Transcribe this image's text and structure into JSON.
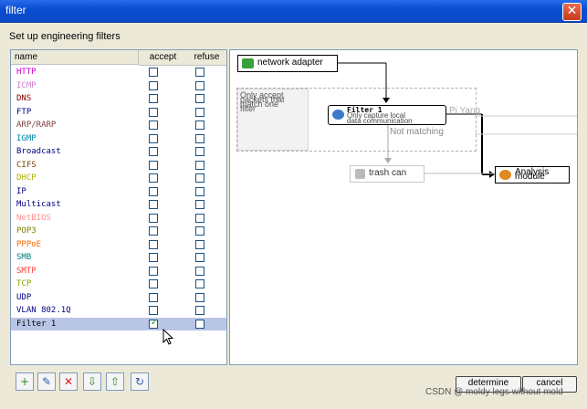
{
  "window": {
    "title": "filter"
  },
  "dialog": {
    "heading": "Set up engineering filters"
  },
  "table": {
    "columns": {
      "name": "name",
      "accept": "accept",
      "refuse": "refuse"
    },
    "rows": [
      {
        "name": "HTTP",
        "color": "#cc00cc",
        "accept": false,
        "refuse": false
      },
      {
        "name": "ICMP",
        "color": "#d080d0",
        "accept": false,
        "refuse": false
      },
      {
        "name": "DNS",
        "color": "#800000",
        "accept": false,
        "refuse": false
      },
      {
        "name": "FTP",
        "color": "#000080",
        "accept": false,
        "refuse": false
      },
      {
        "name": "ARP/RARP",
        "color": "#804040",
        "accept": false,
        "refuse": false
      },
      {
        "name": "IGMP",
        "color": "#0088aa",
        "accept": false,
        "refuse": false
      },
      {
        "name": "Broadcast",
        "color": "#000080",
        "accept": false,
        "refuse": false
      },
      {
        "name": "CIFS",
        "color": "#804000",
        "accept": false,
        "refuse": false
      },
      {
        "name": "DHCP",
        "color": "#b0b000",
        "accept": false,
        "refuse": false
      },
      {
        "name": "IP",
        "color": "#000080",
        "accept": false,
        "refuse": false
      },
      {
        "name": "Multicast",
        "color": "#000080",
        "accept": false,
        "refuse": false
      },
      {
        "name": "NetBIOS",
        "color": "#ff9090",
        "accept": false,
        "refuse": false
      },
      {
        "name": "POP3",
        "color": "#808000",
        "accept": false,
        "refuse": false
      },
      {
        "name": "PPPoE",
        "color": "#ff6600",
        "accept": false,
        "refuse": false
      },
      {
        "name": "SMB",
        "color": "#008080",
        "accept": false,
        "refuse": false
      },
      {
        "name": "SMTP",
        "color": "#ff4040",
        "accept": false,
        "refuse": false
      },
      {
        "name": "TCP",
        "color": "#80a000",
        "accept": false,
        "refuse": false
      },
      {
        "name": "UDP",
        "color": "#000080",
        "accept": false,
        "refuse": false
      },
      {
        "name": "VLAN 802.1Q",
        "color": "#000080",
        "accept": false,
        "refuse": false
      },
      {
        "name": "Filter 1",
        "color": "#000000",
        "accept": true,
        "refuse": false,
        "selected": true
      }
    ]
  },
  "diagram": {
    "network_adapter": "network adapter",
    "grey_line1": "Only accept",
    "grey_line2": "packets that",
    "grey_line3": "match one",
    "grey_line4": "filter",
    "filter1_title": "Filter 1",
    "filter1_line2": "Only capture local",
    "filter1_line3": "data communication",
    "not_matching": "Not matching",
    "trash_can": "trash can",
    "analysis_line1": "Analysis",
    "analysis_line2": "module",
    "overlay_text": "Pi Yang"
  },
  "toolbar": {
    "icons": [
      "add-filter-icon",
      "edit-filter-icon",
      "delete-filter-icon",
      "import-icon",
      "export-icon",
      "refresh-icon"
    ]
  },
  "buttons": {
    "determine": "determine",
    "cancel": "cancel"
  },
  "watermark": "CSDN @ moldy legs without mold"
}
